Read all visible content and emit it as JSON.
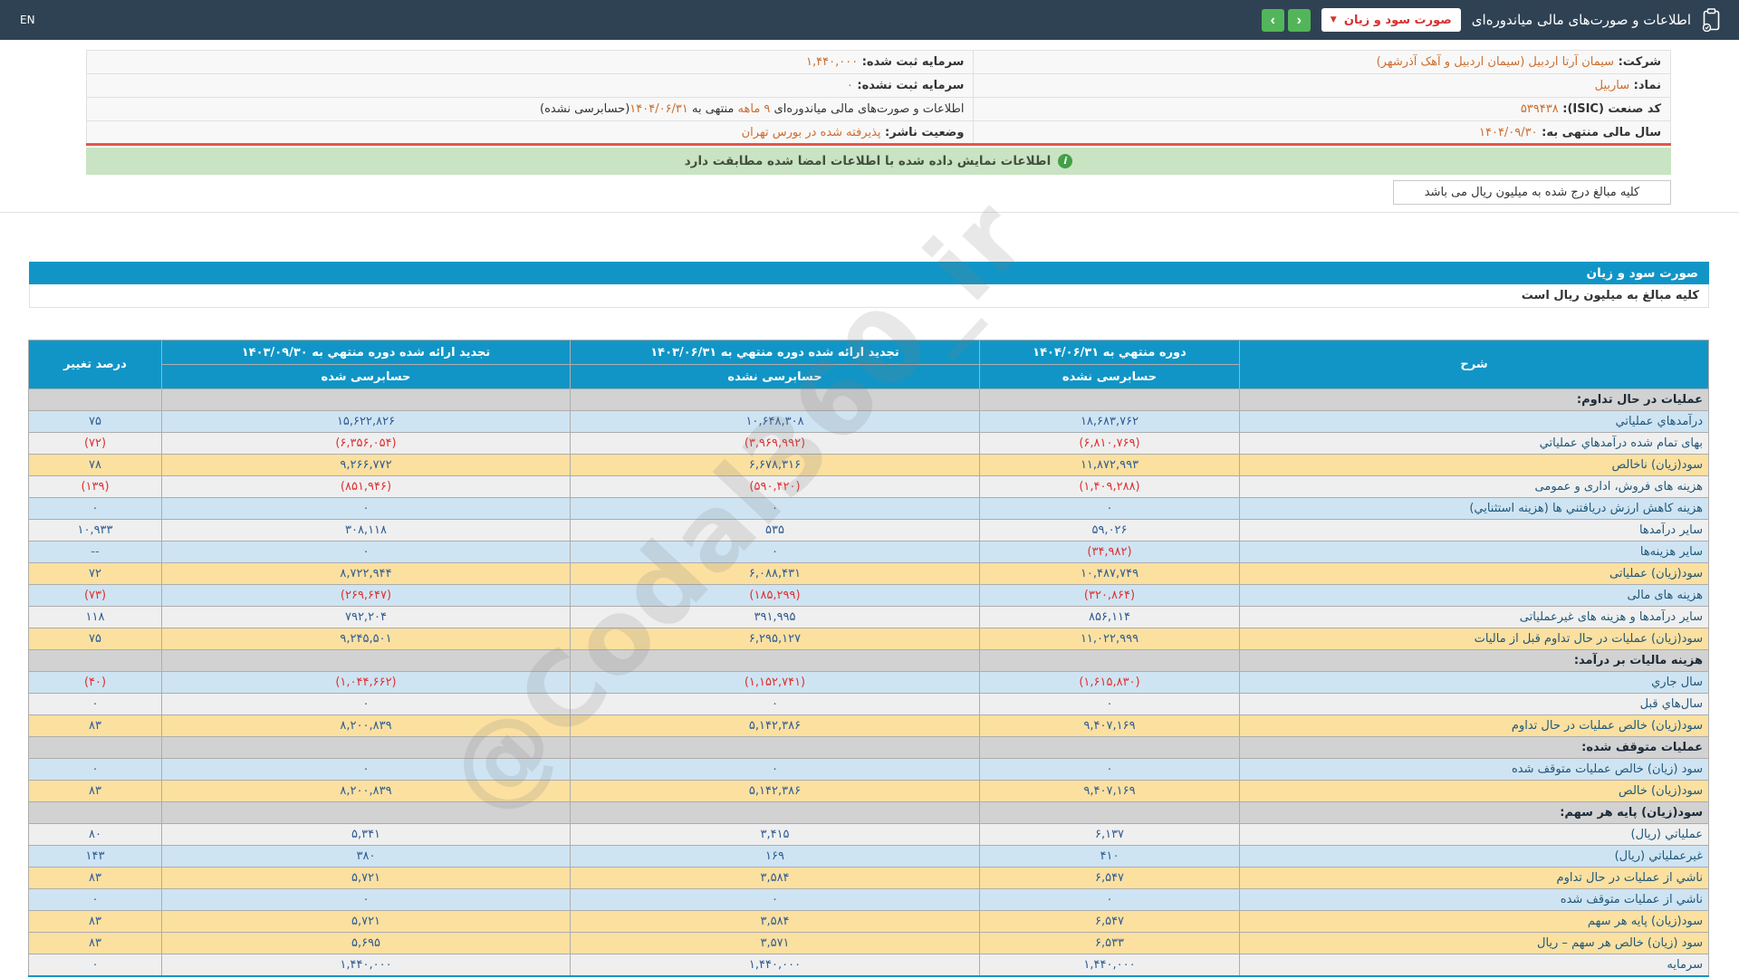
{
  "header": {
    "title": "اطلاعات و صورت‌های مالی میاندوره‌ای",
    "dropdown_value": "صورت سود و زیان",
    "dropdown_caret": "▼",
    "nav_forward": "›",
    "nav_back": "‹",
    "lang_label": "EN"
  },
  "colors": {
    "topbar": "#2f4254",
    "accent_blue": "#1195c6",
    "nav_green": "#53b559",
    "dropdown_red": "#d63230",
    "value_orange": "#cc6e30",
    "row_blue": "#cfe4f2",
    "row_yellow": "#fbe0a0",
    "row_gray": "#d2d2d2",
    "negative_red": "#e03030",
    "positive_blue": "#2e5c94",
    "notice_green_bg": "#c9e4c2",
    "red_separator": "#e2574d"
  },
  "company_info": {
    "rows": [
      {
        "right": [
          {
            "t": "شرکت: ",
            "c": "lbl"
          },
          {
            "t": "سیمان آرتا اردبیل (سیمان اردبیل و آهک آذرشهر)",
            "c": "val"
          }
        ],
        "left": [
          {
            "t": "سرمایه ثبت شده: ",
            "c": "lbl"
          },
          {
            "t": "۱,۴۴۰,۰۰۰",
            "c": "val"
          }
        ]
      },
      {
        "right": [
          {
            "t": "نماد: ",
            "c": "lbl"
          },
          {
            "t": "ساربیل",
            "c": "val"
          }
        ],
        "left": [
          {
            "t": "سرمایه ثبت نشده: ",
            "c": "lbl"
          },
          {
            "t": "۰",
            "c": "val"
          }
        ]
      },
      {
        "right": [
          {
            "t": "کد صنعت (ISIC): ",
            "c": "lbl"
          },
          {
            "t": "۵۳۹۴۳۸",
            "c": "val"
          }
        ],
        "left": [
          {
            "t": "اطلاعات و صورت‌های مالی میاندوره‌ای ",
            "c": "txt"
          },
          {
            "t": "۹ ماهه",
            "c": "val"
          },
          {
            "t": " منتهی به ",
            "c": "txt"
          },
          {
            "t": "۱۴۰۴/۰۶/۳۱",
            "c": "val"
          },
          {
            "t": "(حسابرسی نشده)",
            "c": "txt"
          }
        ]
      },
      {
        "right": [
          {
            "t": "سال مالی منتهی به: ",
            "c": "lbl"
          },
          {
            "t": "۱۴۰۴/۰۹/۳۰",
            "c": "val"
          }
        ],
        "left": [
          {
            "t": "وضعیت ناشر: ",
            "c": "lbl"
          },
          {
            "t": "پذیرفته شده در بورس تهران",
            "c": "val"
          }
        ]
      }
    ]
  },
  "notice": {
    "text": "اطلاعات نمایش داده شده با اطلاعات امضا شده مطابقت دارد",
    "icon": "i"
  },
  "amounts_note": "کلیه مبالغ درج شده به میلیون ریال می باشد",
  "statement": {
    "title": "صورت سود و زیان",
    "unit_note": "کلیه مبالغ به میلیون ریال است",
    "columns": {
      "desc": "شرح",
      "current_title": "دوره منتهي به ۱۴۰۴/۰۶/۳۱",
      "current_sub": "حسابرسی نشده",
      "restated_prior_title": "تجدید ارائه شده دوره منتهي به ۱۴۰۳/۰۶/۳۱",
      "restated_prior_sub": "حسابرسی نشده",
      "restated_annual_title": "تجدید ارائه شده دوره منتهي به ۱۴۰۳/۰۹/۳۰",
      "restated_annual_sub": "حسابرسی شده",
      "pct": "درصد تغییر"
    },
    "rows": [
      {
        "label": "عملیات در حال تداوم:",
        "bg": "section"
      },
      {
        "label": "درآمدهاي عملياتي",
        "values": [
          "۱۸,۶۸۳,۷۶۲",
          "۱۰,۶۴۸,۳۰۸",
          "۱۵,۶۲۲,۸۲۶",
          "۷۵"
        ],
        "bg": "blue"
      },
      {
        "label": "بهای تمام شده درآمدهاي عملياتي",
        "values": [
          "(۶,۸۱۰,۷۶۹)",
          "(۳,۹۶۹,۹۹۲)",
          "(۶,۳۵۶,۰۵۴)",
          "(۷۲)"
        ],
        "bg": "white"
      },
      {
        "label": "سود(زیان) ناخالص",
        "values": [
          "۱۱,۸۷۲,۹۹۳",
          "۶,۶۷۸,۳۱۶",
          "۹,۲۶۶,۷۷۲",
          "۷۸"
        ],
        "bg": "yellow"
      },
      {
        "label": "هزینه های فروش، اداری و عمومی",
        "values": [
          "(۱,۴۰۹,۲۸۸)",
          "(۵۹۰,۴۲۰)",
          "(۸۵۱,۹۴۶)",
          "(۱۳۹)"
        ],
        "bg": "white"
      },
      {
        "label": "هزینه کاهش ارزش دریافتني ها (هزینه استثنايي)",
        "values": [
          "۰",
          "۰",
          "۰",
          "۰"
        ],
        "bg": "blue"
      },
      {
        "label": "سایر درآمدها",
        "values": [
          "۵۹,۰۲۶",
          "۵۳۵",
          "۳۰۸,۱۱۸",
          "۱۰,۹۳۳"
        ],
        "bg": "white"
      },
      {
        "label": "سایر هزینه‌ها",
        "values": [
          "(۳۴,۹۸۲)",
          "۰",
          "۰",
          "--"
        ],
        "bg": "blue"
      },
      {
        "label": "سود(زیان) عملیاتی",
        "values": [
          "۱۰,۴۸۷,۷۴۹",
          "۶,۰۸۸,۴۳۱",
          "۸,۷۲۲,۹۴۴",
          "۷۲"
        ],
        "bg": "yellow"
      },
      {
        "label": "هزینه های مالی",
        "values": [
          "(۳۲۰,۸۶۴)",
          "(۱۸۵,۲۹۹)",
          "(۲۶۹,۶۴۷)",
          "(۷۳)"
        ],
        "bg": "blue"
      },
      {
        "label": "سایر درآمدها و هزینه های غیرعملیاتی",
        "values": [
          "۸۵۶,۱۱۴",
          "۳۹۱,۹۹۵",
          "۷۹۲,۲۰۴",
          "۱۱۸"
        ],
        "bg": "white"
      },
      {
        "label": "سود(زیان) عملیات در حال تداوم قبل از مالیات",
        "values": [
          "۱۱,۰۲۲,۹۹۹",
          "۶,۲۹۵,۱۲۷",
          "۹,۲۴۵,۵۰۱",
          "۷۵"
        ],
        "bg": "yellow"
      },
      {
        "label": "هزینه مالیات بر درآمد:",
        "bg": "section"
      },
      {
        "label": "سال جاري",
        "values": [
          "(۱,۶۱۵,۸۳۰)",
          "(۱,۱۵۲,۷۴۱)",
          "(۱,۰۴۴,۶۶۲)",
          "(۴۰)"
        ],
        "bg": "blue"
      },
      {
        "label": "سال‌هاي قبل",
        "values": [
          "۰",
          "۰",
          "۰",
          "۰"
        ],
        "bg": "white"
      },
      {
        "label": "سود(زیان) خالص عملیات در حال تداوم",
        "values": [
          "۹,۴۰۷,۱۶۹",
          "۵,۱۴۲,۳۸۶",
          "۸,۲۰۰,۸۳۹",
          "۸۳"
        ],
        "bg": "yellow"
      },
      {
        "label": "عملیات متوقف شده:",
        "bg": "section"
      },
      {
        "label": "سود (زیان) خالص عملیات متوقف شده",
        "values": [
          "۰",
          "۰",
          "۰",
          "۰"
        ],
        "bg": "blue"
      },
      {
        "label": "سود(زیان) خالص",
        "values": [
          "۹,۴۰۷,۱۶۹",
          "۵,۱۴۲,۳۸۶",
          "۸,۲۰۰,۸۳۹",
          "۸۳"
        ],
        "bg": "yellow"
      },
      {
        "label": "سود(زیان) پایه هر سهم:",
        "bg": "section"
      },
      {
        "label": "عملياتي (ريال)",
        "values": [
          "۶,۱۳۷",
          "۳,۴۱۵",
          "۵,۳۴۱",
          "۸۰"
        ],
        "bg": "white"
      },
      {
        "label": "غیرعملياتي (ريال)",
        "values": [
          "۴۱۰",
          "۱۶۹",
          "۳۸۰",
          "۱۴۳"
        ],
        "bg": "blue"
      },
      {
        "label": "ناشي از عملیات در حال تداوم",
        "values": [
          "۶,۵۴۷",
          "۳,۵۸۴",
          "۵,۷۲۱",
          "۸۳"
        ],
        "bg": "yellow"
      },
      {
        "label": "ناشي از عملیات متوقف شده",
        "values": [
          "۰",
          "۰",
          "۰",
          "۰"
        ],
        "bg": "blue"
      },
      {
        "label": "سود(زیان) پایه هر سهم",
        "values": [
          "۶,۵۴۷",
          "۳,۵۸۴",
          "۵,۷۲۱",
          "۸۳"
        ],
        "bg": "yellow"
      },
      {
        "label": "سود (زیان) خالص هر سهم – ریال",
        "values": [
          "۶,۵۳۳",
          "۳,۵۷۱",
          "۵,۶۹۵",
          "۸۳"
        ],
        "bg": "yellow"
      },
      {
        "label": "سرمایه",
        "values": [
          "۱,۴۴۰,۰۰۰",
          "۱,۴۴۰,۰۰۰",
          "۱,۴۴۰,۰۰۰",
          "۰"
        ],
        "bg": "white"
      }
    ]
  },
  "watermark": "@Codal360_ir"
}
